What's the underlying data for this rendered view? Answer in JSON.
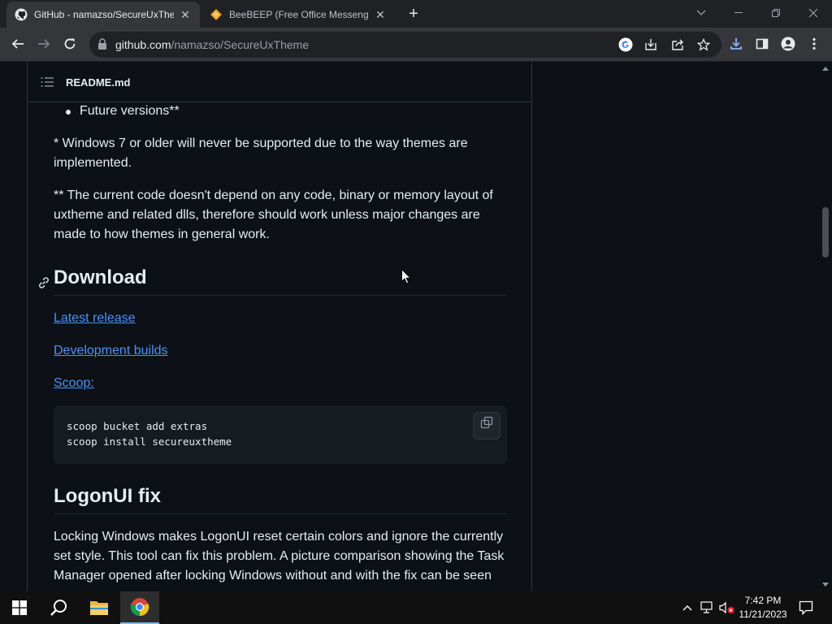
{
  "browser": {
    "tabs": [
      {
        "title": "GitHub - namazso/SecureUxTheme",
        "active": true,
        "favicon": "github-icon"
      },
      {
        "title": "BeeBEEP (Free Office Messenger)",
        "active": false,
        "favicon": "beebeep-icon"
      }
    ],
    "new_tab_symbol": "+",
    "url_host": "github.com",
    "url_path": "/namazso/SecureUxTheme"
  },
  "readme": {
    "filename": "README.md",
    "bullet_item": "Future versions**",
    "note_windows7": "* Windows 7 or older will never be supported due to the way themes are implemented.",
    "note_current_code": "** The current code doesn't depend on any code, binary or memory layout of uxtheme and related dlls, therefore should work unless major changes are made to how themes in general work.",
    "download_heading": "Download",
    "links": {
      "latest_release": "Latest release",
      "development_builds": "Development builds",
      "scoop": "Scoop:"
    },
    "code_line1": "scoop bucket add extras",
    "code_line2": "scoop install secureuxtheme",
    "logonui_heading": "LogonUI fix",
    "logonui_text": "Locking Windows makes LogonUI reset certain colors and ignore the currently set style. This tool can fix this problem. A picture comparison showing the Task Manager opened after locking Windows without and with the fix can be seen"
  },
  "taskbar": {
    "time": "7:42 PM",
    "date": "11/21/2023"
  },
  "colors": {
    "accent_link": "#4493f8",
    "page_bg": "#0d1117",
    "text": "#e6edf3"
  }
}
